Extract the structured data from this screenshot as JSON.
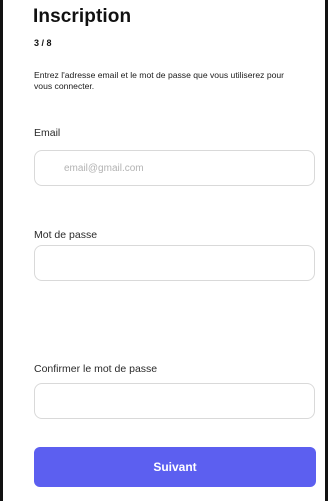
{
  "header": {
    "title": "Inscription",
    "step": "3 / 8"
  },
  "intro": {
    "text": "Entrez l'adresse email et le mot de passe que vous utiliserez pour vous connecter."
  },
  "form": {
    "email": {
      "label": "Email",
      "placeholder": "email@gmail.com",
      "value": ""
    },
    "password": {
      "label": "Mot de passe",
      "placeholder": "",
      "value": ""
    },
    "confirm_password": {
      "label": "Confirmer le mot de passe",
      "placeholder": "",
      "value": ""
    }
  },
  "actions": {
    "next_label": "Suivant"
  },
  "colors": {
    "accent": "#5c5ff0",
    "input_border": "#d9d9d9",
    "placeholder": "#b3b3b3",
    "frame_edge": "#111111"
  }
}
